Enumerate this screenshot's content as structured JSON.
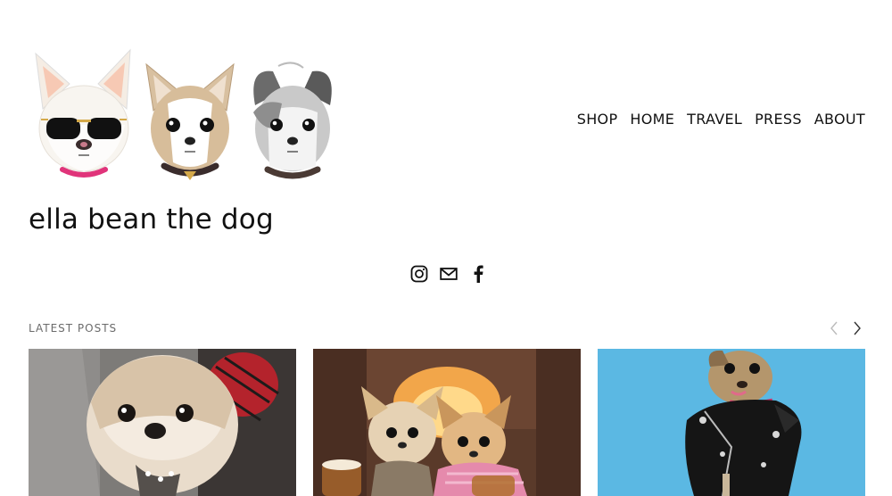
{
  "header": {
    "logo_alt_dogs": [
      "dog-with-sunglasses",
      "chihuahua",
      "grey-terrier"
    ]
  },
  "nav": {
    "items": [
      {
        "label": "SHOP"
      },
      {
        "label": "HOME"
      },
      {
        "label": "TRAVEL"
      },
      {
        "label": "PRESS"
      },
      {
        "label": "ABOUT"
      }
    ]
  },
  "site": {
    "title": "ella bean the dog"
  },
  "social": {
    "icons": [
      "instagram-icon",
      "mail-icon",
      "facebook-icon"
    ]
  },
  "latest_posts": {
    "label": "LATEST POSTS",
    "posts": [
      {
        "image": "shih-tzu-with-plaid-bow"
      },
      {
        "image": "chihuahuas-by-fireplace"
      },
      {
        "image": "dog-in-leather-jacket"
      }
    ]
  },
  "colors": {
    "text": "#111111",
    "muted": "#6b6b6b",
    "arrow_disabled": "#bbbbbb",
    "blue_bg": "#5bb8e3"
  }
}
